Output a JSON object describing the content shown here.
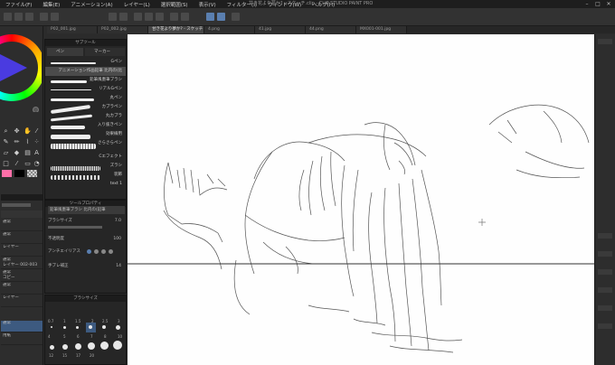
{
  "window": {
    "title": "甘き花より夢か? - スケッチ.clip - CLIP STUDIO PAINT PRO",
    "min_btn": "–",
    "max_btn": "□",
    "close_btn": "✕"
  },
  "menu": [
    "ファイル(F)",
    "編集(E)",
    "アニメーション(A)",
    "レイヤー(L)",
    "選択範囲(S)",
    "表示(V)",
    "フィルター(I)",
    "ウィンドウ(W)",
    "ヘルプ(H)"
  ],
  "doc_tabs": [
    "P02_001.jpg",
    "P02_002.jpg",
    "甘き花より夢か? - スケッチ",
    "4.png",
    "41.jpg",
    "44.png",
    "MX001-001.jpg"
  ],
  "brush_panel": {
    "title": "サブツール",
    "tabs": [
      "ペン",
      "マーカー"
    ],
    "items": [
      "Gペン",
      "アニメーション作画鉛筆 比内の(比",
      "丸ペン",
      "鉛筆風墨筆ブラシ",
      "リアルGペン",
      "丸ペン",
      "カブラペン",
      "丸カブラ",
      "入り抜きペン",
      "効果線用",
      "さらさらペン",
      "Cエフェクト",
      "ズラシ",
      "装飾",
      "text 1"
    ]
  },
  "tool_property": {
    "title": "ツールプロパティ",
    "name": "鉛筆風墨筆ブラシ 比内の(鉛筆",
    "rows": [
      {
        "label": "ブラシサイズ",
        "value": "7.0"
      },
      {
        "label": "不透明度",
        "value": "100"
      },
      {
        "label": "アンチエイリアス",
        "value": ""
      },
      {
        "label": "手ブレ補正",
        "value": "14"
      }
    ]
  },
  "brush_size": {
    "title": "ブラシサイズ",
    "labels": [
      "0.7",
      "1",
      "1.5",
      "2",
      "2.5",
      "3",
      "4",
      "5",
      "6",
      "7",
      "8",
      "10",
      "12",
      "15",
      "17",
      "20"
    ]
  },
  "palette": {
    "title": "カラーセット",
    "name": "鉛筆描き系パレット"
  },
  "effect": {
    "title": "レイヤープロパティ",
    "tab": "効果",
    "label": "表現色",
    "value": "カラー"
  },
  "layers": [
    "通常",
    "通常",
    "レイヤー",
    "通常",
    "レイヤー 002-003",
    "通常",
    "コピー",
    "通常",
    "レイヤー",
    "通常",
    "用紙"
  ],
  "colors": {
    "accent": "#5a7fb0",
    "main_color": "#ff6fa8",
    "selected_layer": "#3d5a80"
  }
}
